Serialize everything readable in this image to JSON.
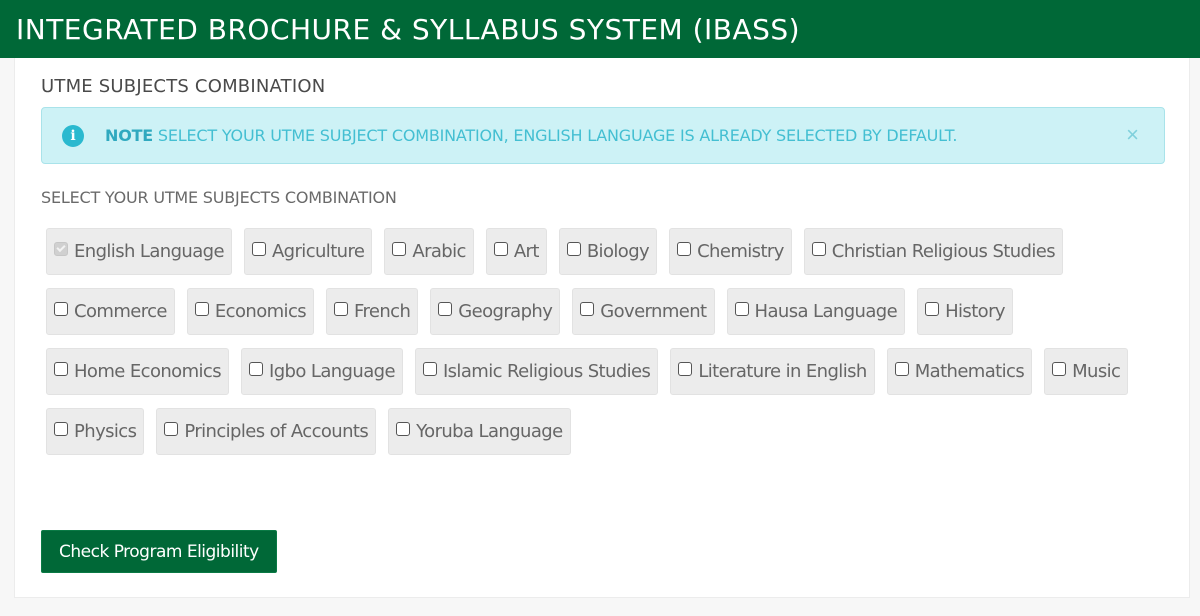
{
  "header": {
    "title": "INTEGRATED BROCHURE & SYLLABUS SYSTEM (IBASS)",
    "brand_color": "#006837"
  },
  "section": {
    "title": "UTME SUBJECTS COMBINATION"
  },
  "alert": {
    "icon": "info-icon",
    "label": "NOTE",
    "message": " SELECT YOUR UTME SUBJECT COMBINATION, ENGLISH LANGUAGE IS ALREADY SELECTED BY DEFAULT.",
    "close_label": "×"
  },
  "subjects_label": "SELECT YOUR UTME SUBJECTS COMBINATION",
  "subjects": [
    {
      "label": "English Language",
      "checked": true,
      "disabled": true
    },
    {
      "label": "Agriculture",
      "checked": false
    },
    {
      "label": "Arabic",
      "checked": false
    },
    {
      "label": "Art",
      "checked": false
    },
    {
      "label": "Biology",
      "checked": false
    },
    {
      "label": "Chemistry",
      "checked": false
    },
    {
      "label": "Christian Religious Studies",
      "checked": false
    },
    {
      "label": "Commerce",
      "checked": false
    },
    {
      "label": "Economics",
      "checked": false
    },
    {
      "label": "French",
      "checked": false
    },
    {
      "label": "Geography",
      "checked": false
    },
    {
      "label": "Government",
      "checked": false
    },
    {
      "label": "Hausa Language",
      "checked": false
    },
    {
      "label": "History",
      "checked": false
    },
    {
      "label": "Home Economics",
      "checked": false
    },
    {
      "label": "Igbo Language",
      "checked": false
    },
    {
      "label": "Islamic Religious Studies",
      "checked": false
    },
    {
      "label": "Literature in English",
      "checked": false
    },
    {
      "label": "Mathematics",
      "checked": false
    },
    {
      "label": "Music",
      "checked": false
    },
    {
      "label": "Physics",
      "checked": false
    },
    {
      "label": "Principles of Accounts",
      "checked": false
    },
    {
      "label": "Yoruba Language",
      "checked": false
    }
  ],
  "actions": {
    "check_eligibility_label": "Check Program Eligibility"
  }
}
